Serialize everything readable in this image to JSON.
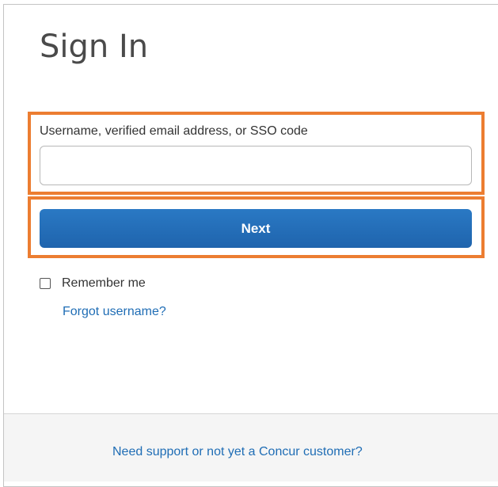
{
  "signin": {
    "title": "Sign In",
    "username_label": "Username, verified email address, or SSO code",
    "username_value": "",
    "next_label": "Next",
    "remember_label": "Remember me",
    "remember_checked": false,
    "forgot_label": "Forgot username?"
  },
  "footer": {
    "support_label": "Need support or not yet a Concur customer?"
  },
  "colors": {
    "highlight": "#ec7d31",
    "button": "#1f64ad",
    "link": "#1f6db5"
  }
}
